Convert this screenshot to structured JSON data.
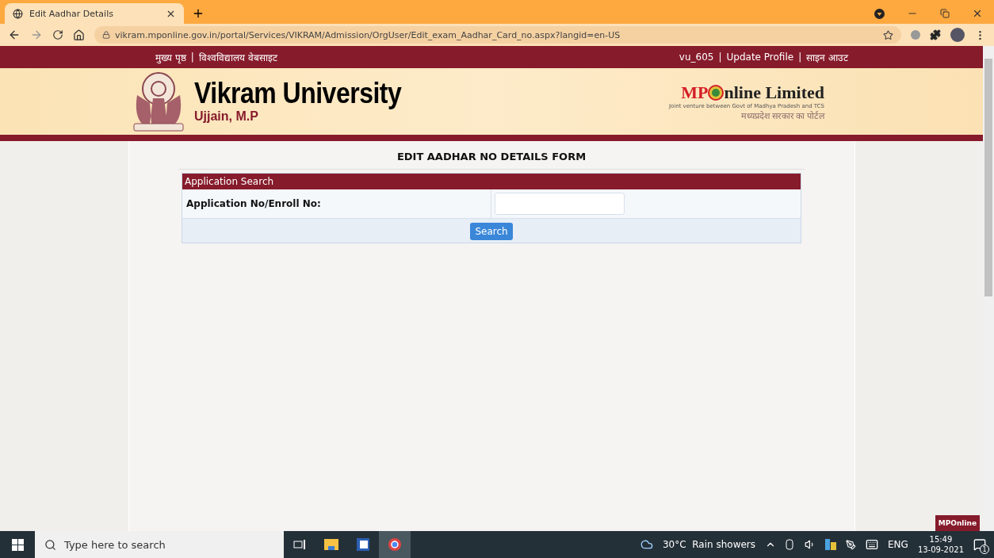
{
  "browser": {
    "tab_title": "Edit Aadhar Details",
    "url": "vikram.mponline.gov.in/portal/Services/VIKRAM/Admission/OrgUser/Edit_exam_Aadhar_Card_no.aspx?langid=en-US"
  },
  "top_nav": {
    "separator": "|",
    "left": [
      "मुख्य पृष्ठ",
      "विश्वविद्यालय वेबसाइट"
    ],
    "right": [
      "vu_605",
      "Update Profile",
      "साइन आउट"
    ]
  },
  "header": {
    "university": "Vikram University",
    "city": "Ujjain, M.P",
    "partner": {
      "mp": "MP",
      "rest": "nline Limited",
      "tagline": "Joint venture between Govt of Madhya Pradesh and TCS",
      "hindi": "मध्यप्रदेश सरकार का पोर्टल"
    }
  },
  "form": {
    "title": "EDIT AADHAR NO DETAILS FORM",
    "section": "Application Search",
    "field_label": "Application No/Enroll No:",
    "button": "Search"
  },
  "corner_badge": "MPOnline",
  "taskbar": {
    "search_placeholder": "Type here to search",
    "weather": "30°C  Rain showers",
    "language": "ENG",
    "time": "15:49",
    "date": "13-09-2021",
    "notifications": "1"
  }
}
